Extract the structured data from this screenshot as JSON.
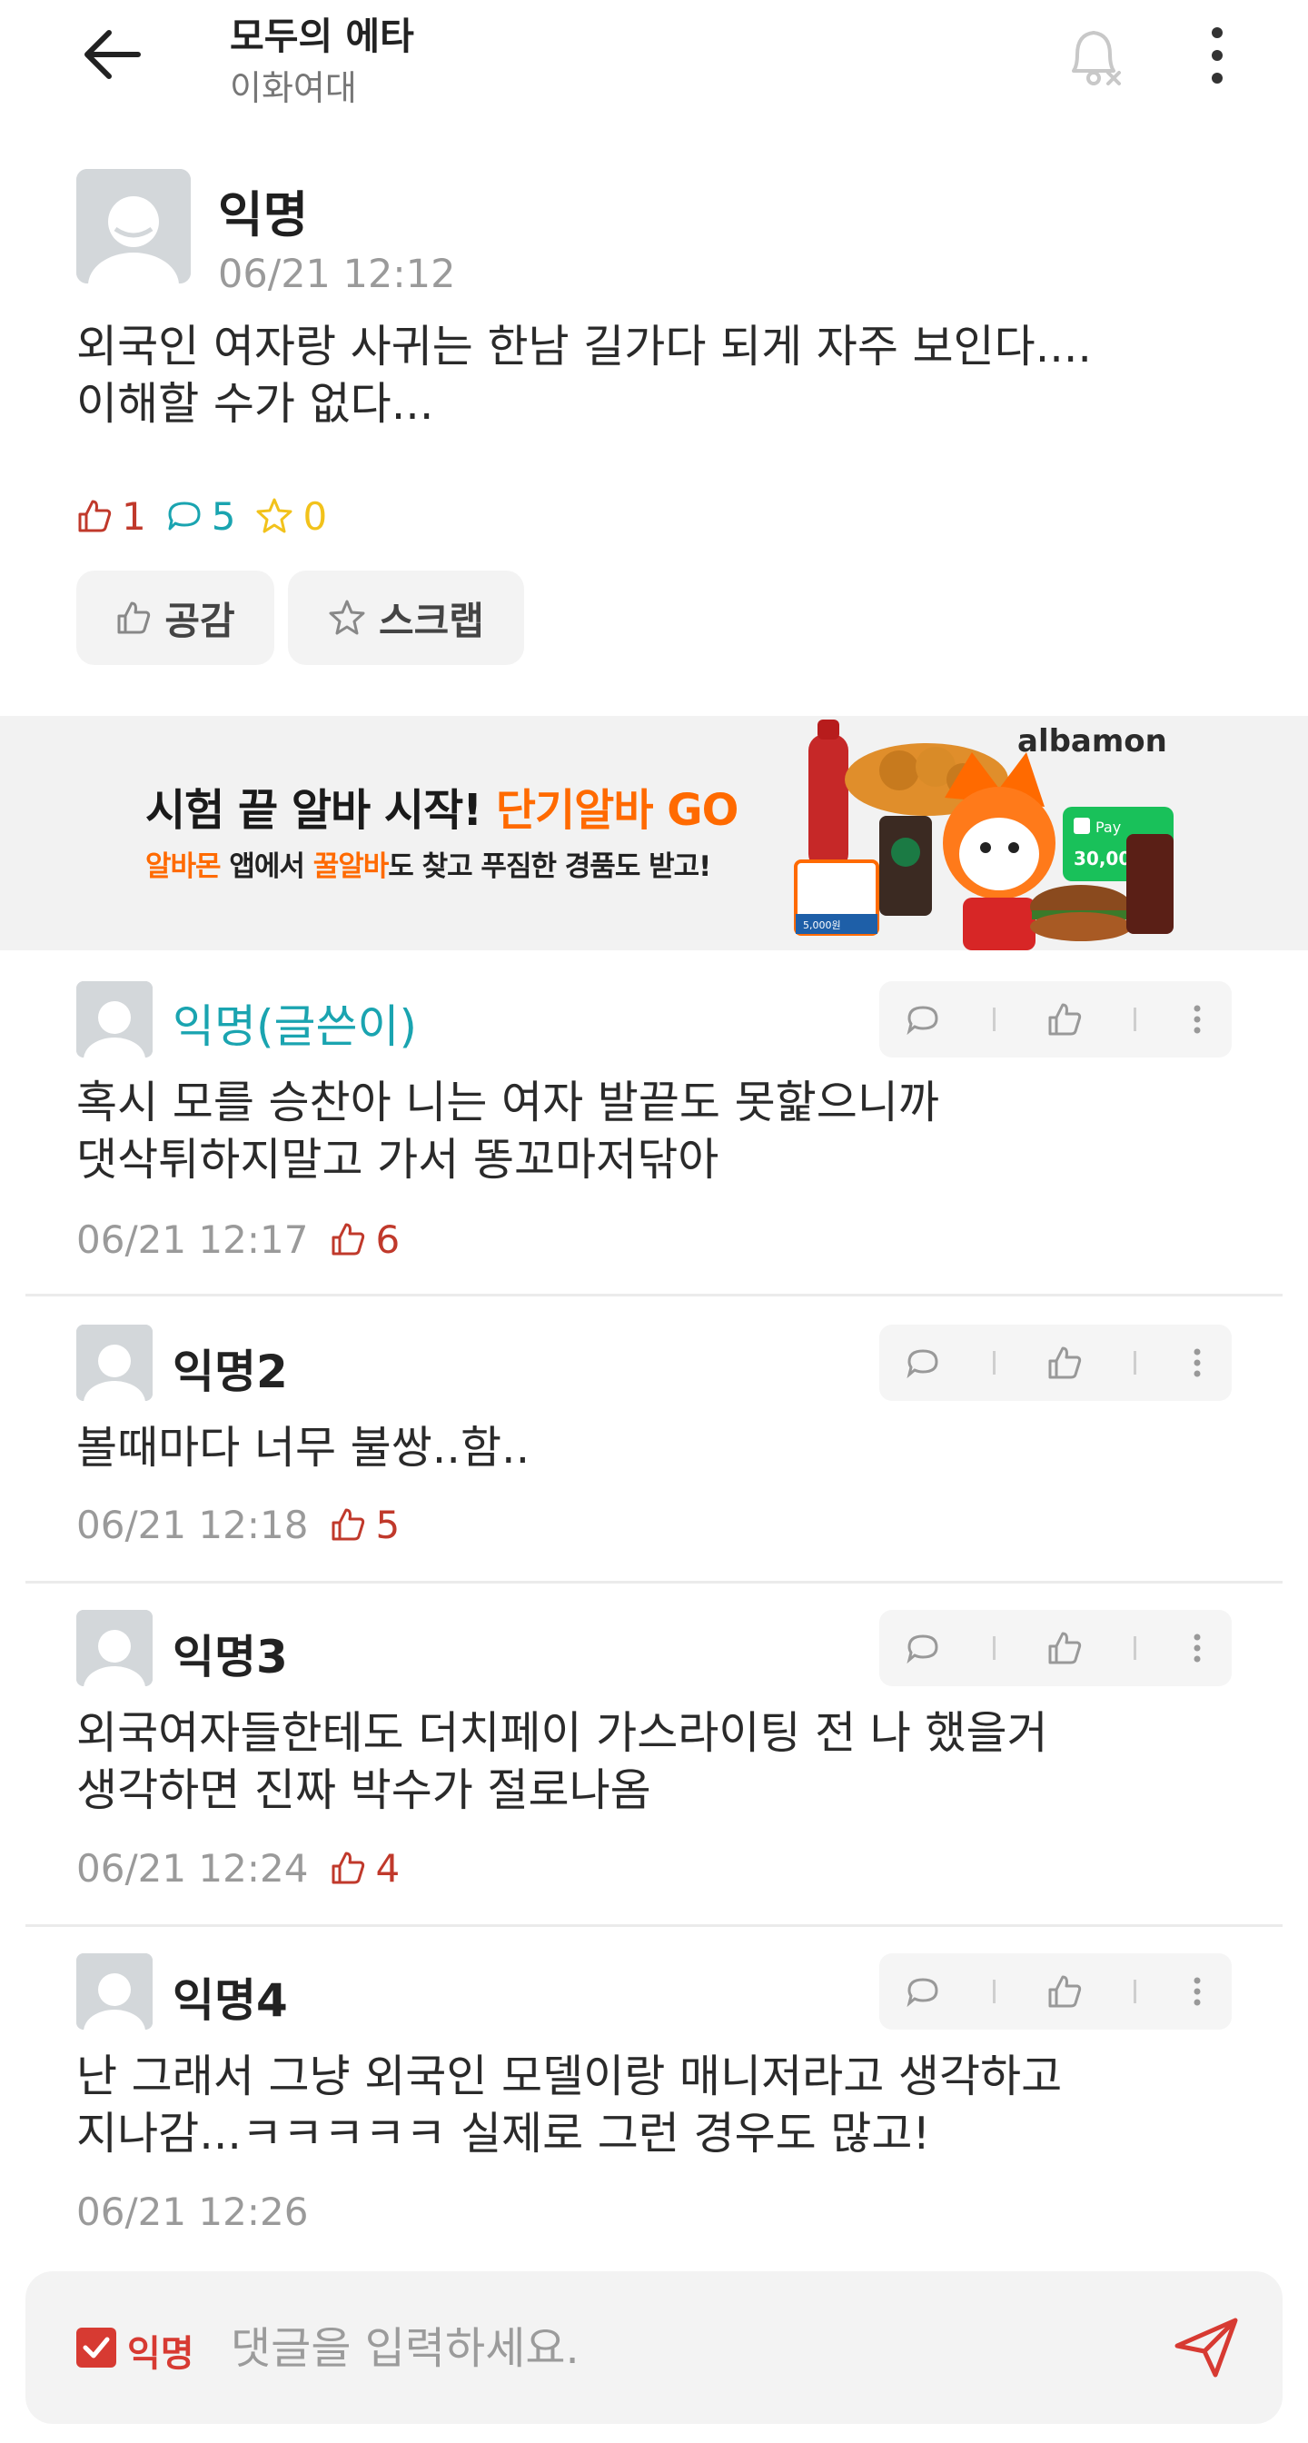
{
  "header": {
    "title": "모두의 에타",
    "subtitle": "이화여대"
  },
  "post": {
    "author": "익명",
    "time": "06/21 12:12",
    "body": "외국인 여자랑 사귀는 한남 길가다 되게 자주 보인다....\n이해할 수가 없다...",
    "likes": "1",
    "comments": "5",
    "scraps": "0",
    "like_button": "공감",
    "scrap_button": "스크랩"
  },
  "ad": {
    "headline_main": "시험 끝 알바 시작! ",
    "headline_highlight": "단기알바 GO",
    "sub_part1": "알바몬",
    "sub_part2": " 앱에서 ",
    "sub_part3": "꿀알바",
    "sub_part4": "도 찾고 푸짐한 경품도 받고!",
    "logo": "albamon",
    "badge_pay": "Pay",
    "badge_amount": "30,000",
    "coupon_amount": "5,000원"
  },
  "comments": [
    {
      "author": "익명(글쓴이)",
      "body": "혹시 모를 승찬아 니는 여자 발끝도 못핥으니까\n댓삭튀하지말고 가서 똥꼬마저닦아",
      "time": "06/21 12:17",
      "likes": "6"
    },
    {
      "author": "익명2",
      "body": "볼때마다 너무 불쌍..함..",
      "time": "06/21 12:18",
      "likes": "5"
    },
    {
      "author": "익명3",
      "body": "외국여자들한테도 더치페이 가스라이팅 전 나 했을거\n생각하면 진짜 박수가 절로나옴",
      "time": "06/21 12:24",
      "likes": "4"
    },
    {
      "author": "익명4",
      "body": "난 그래서 그냥 외국인 모델이랑 매니저라고 생각하고\n지나감...ㅋㅋㅋㅋㅋ 실제로 그런 경우도 많고!",
      "time": "06/21 12:26",
      "likes": ""
    }
  ],
  "input": {
    "anon_label": "익명",
    "placeholder": "댓글을 입력하세요."
  },
  "colors": {
    "accent_red": "#d73a32",
    "op_teal": "#1aa4b0",
    "comment_blue": "#1aa4b0",
    "scrap_yellow": "#f2c21b"
  },
  "icons": [
    "back-arrow-icon",
    "bell-off-icon",
    "more-vertical-icon",
    "thumbs-up-icon",
    "speech-bubble-icon",
    "star-icon",
    "send-icon",
    "checkbox-icon"
  ]
}
